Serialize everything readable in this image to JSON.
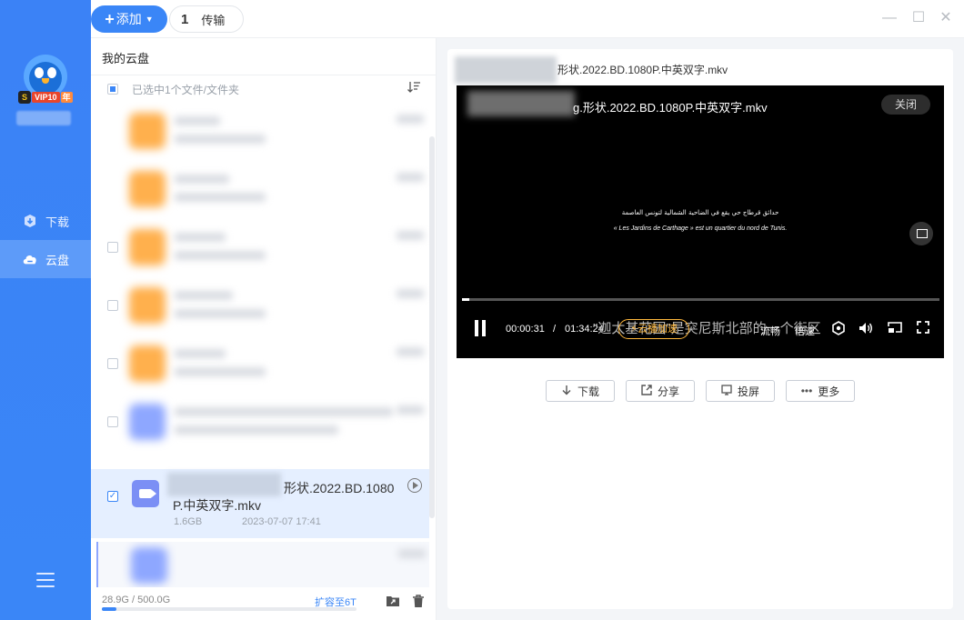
{
  "sidebar": {
    "vip_badge": {
      "s": "S",
      "text": "VIP10",
      "year": "年"
    },
    "items": [
      {
        "label": "下载",
        "icon": "download-icon"
      },
      {
        "label": "云盘",
        "icon": "cloud-icon"
      }
    ],
    "accent": "#3a86f7"
  },
  "topbar": {
    "add_label": "添加",
    "transfer_count": "1",
    "transfer_label": "传输"
  },
  "filepanel": {
    "breadcrumb": "我的云盘",
    "selection_text": "已选中1个文件/文件夹",
    "selected_file": {
      "name_line1": "形状.2022.BD.1080",
      "name_line2": "P.中英双字.mkv",
      "size": "1.6GB",
      "date": "2023-07-07 17:41"
    },
    "storage": "28.9G / 500.0G",
    "storage_fraction": 0.058,
    "expand_label": "扩容至6T"
  },
  "preview": {
    "title": "形状.2022.BD.1080P.中英双字.mkv",
    "player_title": "g.形状.2022.BD.1080P.中英双字.mkv",
    "close_label": "关闭",
    "subtitle_ar": "حدائق قرطاج حي يقع في الضاحية الشمالية لتونس العاصمة",
    "subtitle_fr": "« Les Jardins de Carthage » est un quartier du nord de Tunis.",
    "subtitle_cn": "\"迦太基花园\"是突尼斯北部的一个街区",
    "time_current": "00:00:31",
    "time_separator": "/",
    "time_total": "01:34:24",
    "progress_fraction": 0.005,
    "accel_label": "⚡云播加速",
    "quality": "流畅",
    "speed": "倍速",
    "actions": [
      {
        "label": "下载",
        "icon": "download-icon"
      },
      {
        "label": "分享",
        "icon": "share-icon"
      },
      {
        "label": "投屏",
        "icon": "cast-icon"
      },
      {
        "label": "更多",
        "icon": "more-icon"
      }
    ]
  }
}
